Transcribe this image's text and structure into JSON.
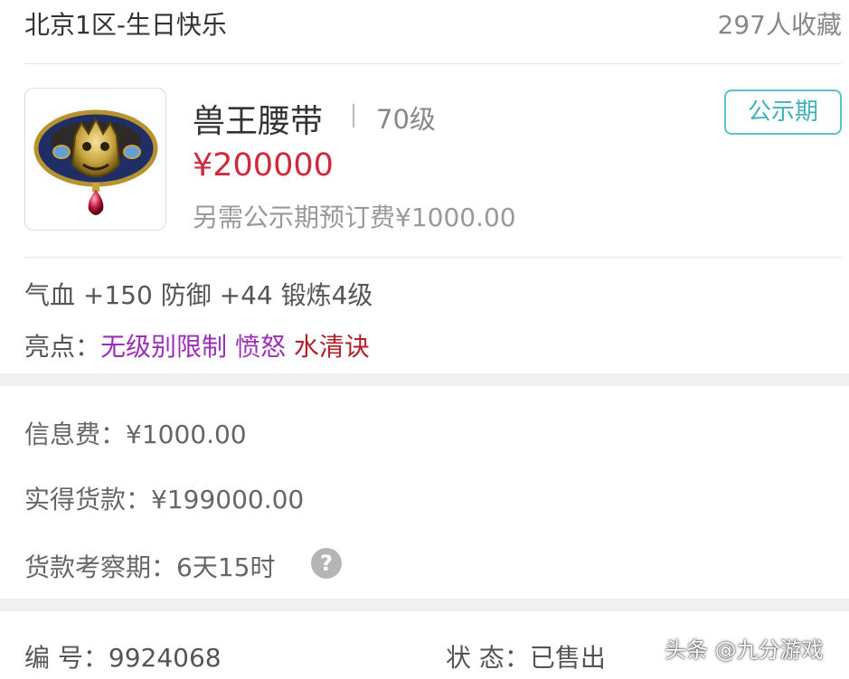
{
  "header": {
    "server": "北京1区-生日快乐",
    "favorites": "297人收藏"
  },
  "item": {
    "name": "兽王腰带",
    "level": "70级",
    "price": "¥200000",
    "extra_fee": "另需公示期预订费¥1000.00",
    "status_badge": "公示期",
    "icon": "belt-item-icon"
  },
  "attributes": {
    "stats": "气血 +150 防御 +44 锻炼4级",
    "highlights_label": "亮点：",
    "highlights": [
      "无级别限制",
      "愤怒",
      "水清诀"
    ]
  },
  "fees": {
    "info_fee": "信息费：¥1000.00",
    "net_payment": "实得货款：¥199000.00",
    "review_period": "货款考察期：6天15时",
    "help_icon": "?"
  },
  "footer": {
    "id_label": "编  号：9924068",
    "status_label": "状  态：已售出"
  },
  "watermark": "头条 @九分游戏",
  "colors": {
    "price_red": "#d0293b",
    "badge_teal": "#41b2bb",
    "highlight_purple": "#9b2fb8",
    "highlight_red": "#b3212a"
  }
}
